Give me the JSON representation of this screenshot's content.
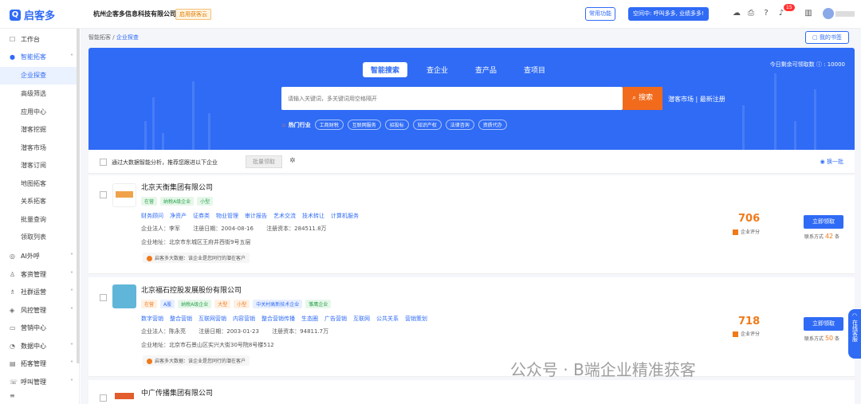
{
  "app": {
    "logo": "启客多",
    "company": "杭州企客多信息科技有限公司",
    "trial": "启用获客云"
  },
  "topbar": {
    "func_btn": "常用功能",
    "promo": "空间中: 呼叫多多, 业绩多多!",
    "notif_count": "15"
  },
  "sidebar": {
    "items": [
      {
        "label": "工作台",
        "icon": "workbench-icon"
      },
      {
        "label": "智能拓客",
        "icon": "smart-icon"
      }
    ],
    "subitems": [
      "企业探查",
      "高级筛选",
      "应用中心",
      "潜客挖掘",
      "潜客市场",
      "潜客订阅",
      "地图拓客",
      "关系拓客",
      "批量查询",
      "领取列表"
    ],
    "groups": [
      "AI外呼",
      "客资管理",
      "社群运营",
      "风控管理",
      "营销中心",
      "数据中心",
      "拓客管理",
      "呼叫管理"
    ]
  },
  "breadcrumb": {
    "root": "智能拓客",
    "sep": "/",
    "current": "企业探查"
  },
  "bookmark": "我的书签",
  "hero": {
    "tabs": [
      "智能搜索",
      "查企业",
      "查产品",
      "查项目"
    ],
    "quota": "今日剩余可领取数 ⓘ : 10000",
    "search_placeholder": "请输入关键词，多关键词用空格隔开",
    "search_btn": "搜索",
    "links": "潜客市场 | 最新注册",
    "hot_label": "热门行业",
    "hot_tags": [
      "工商财税",
      "互联网服务",
      "招投标",
      "知识产权",
      "法律咨询",
      "资质代办"
    ]
  },
  "recommend": {
    "text": "通过大数据智能分析，推荐您跟进以下企业",
    "batch": "批量领取",
    "refresh": "换一批"
  },
  "companies": [
    {
      "name": "北京天衡集团有限公司",
      "tags": [
        [
          "在营",
          "g"
        ],
        [
          "纳税A级企业",
          "g"
        ],
        [
          "小型",
          "g"
        ]
      ],
      "keywords": [
        "财务顾问",
        "净资产",
        "证券类",
        "物业管理",
        "审计报告",
        "艺术交流",
        "技术转让",
        "计算机服务"
      ],
      "legal": "企业法人：李军",
      "date": "注册日期：2004-08-16",
      "capital": "注册资本：284511.8万",
      "address": "企业地址：北京市东城区王府井西街9号五层",
      "hint": "启客多大数据：该企业是您同行的潜在客户",
      "score": "706",
      "score_label": "企业评分",
      "claim": "立即领取",
      "contact_pre": "联系方式",
      "contact_num": "42",
      "contact_suf": "条"
    },
    {
      "name": "北京福石控股发展股份有限公司",
      "tags": [
        [
          "在营",
          "o"
        ],
        [
          "A股",
          "b"
        ],
        [
          "纳税A级企业",
          "g"
        ],
        [
          "大型",
          "o"
        ],
        [
          "小型",
          "o"
        ],
        [
          "中关村高新技术企业",
          "b"
        ],
        [
          "雏鹰企业",
          "g"
        ]
      ],
      "keywords": [
        "数字营销",
        "整合营销",
        "互联网营销",
        "内容营销",
        "整合营销传播",
        "生态圈",
        "广告营销",
        "互联网",
        "公共关系",
        "营销策划"
      ],
      "legal": "企业法人：陈永亮",
      "date": "注册日期：2003-01-23",
      "capital": "注册资本：94811.7万",
      "address": "企业地址：北京市石景山区实兴大街30号院8号楼512",
      "hint": "启客多大数据：该企业是您同行的潜在客户",
      "score": "718",
      "score_label": "企业评分",
      "claim": "立即领取",
      "contact_pre": "联系方式",
      "contact_num": "50",
      "contact_suf": "条"
    },
    {
      "name": "中广传播集团有限公司"
    }
  ],
  "online_service": "在线客服",
  "watermark": "公众号 · B端企业精准获客",
  "colors": {
    "primary": "#2f6bf5",
    "accent": "#f26a1b"
  }
}
